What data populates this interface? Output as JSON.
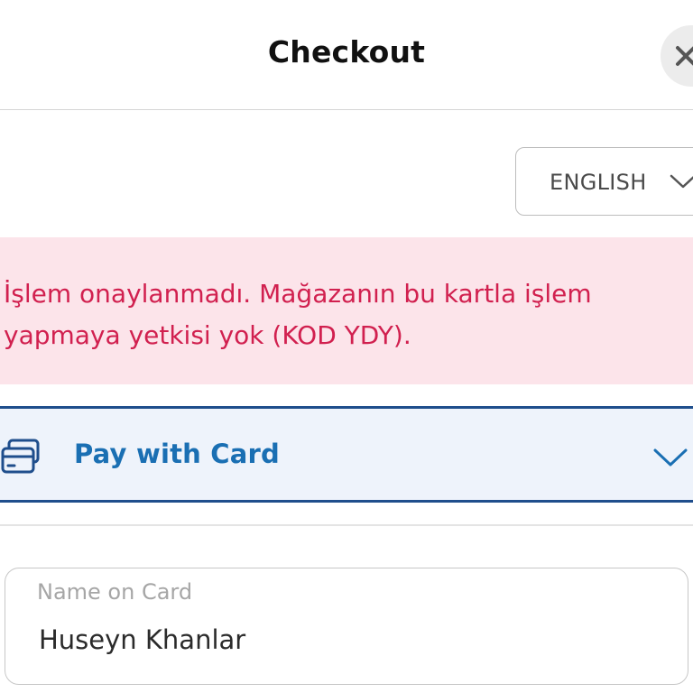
{
  "header": {
    "title": "Checkout",
    "close_icon": "close-icon"
  },
  "language": {
    "selected": "ENGLISH",
    "icon": "chevron-down-icon"
  },
  "alert": {
    "message": "İşlem onaylanmadı. Mağazanın bu kartla işlem yapmaya yetkisi yok (KOD YDY).",
    "color": "#d1204f",
    "background": "#fce4ea"
  },
  "payment_method": {
    "label": "Pay with Card",
    "icon": "credit-card-icon",
    "expand_icon": "chevron-down-icon",
    "accent": "#1a6fb3",
    "border": "#1f4e8c"
  },
  "form": {
    "name_on_card": {
      "label": "Name on Card",
      "value": "Huseyn Khanlar"
    }
  }
}
